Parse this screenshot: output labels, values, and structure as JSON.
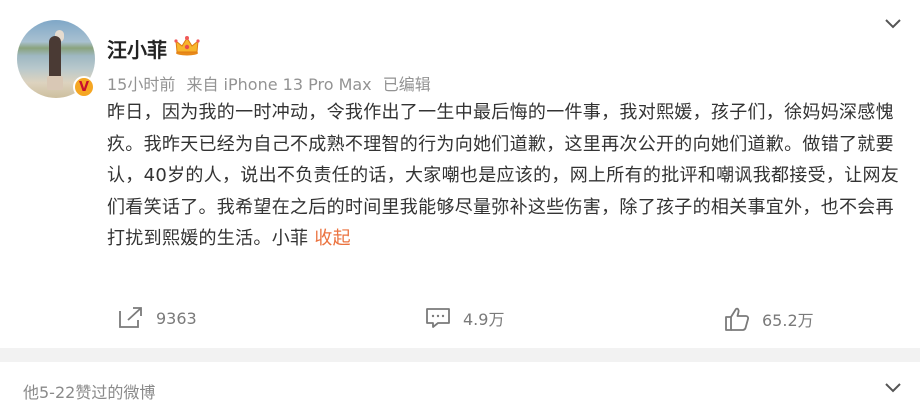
{
  "user": {
    "name": "汪小菲",
    "avatar_icon": "avatar-photo",
    "badge_label": "V",
    "crown_icon": "crown-icon"
  },
  "meta": {
    "time": "15小时前",
    "source": "来自 iPhone 13 Pro Max",
    "edited": "已编辑"
  },
  "post": {
    "text": "昨日，因为我的一时冲动，令我作出了一生中最后悔的一件事，我对熙媛，孩子们，徐妈妈深感愧疚。我昨天已经为自己不成熟不理智的行为向她们道歉，这里再次公开的向她们道歉。做错了就要认，40岁的人，说出不负责任的话，大家嘲也是应该的，网上所有的批评和嘲讽我都接受，让网友们看笑话了。我希望在之后的时间里我能够尽量弥补这些伤害，除了孩子的相关事宜外，也不会再打扰到熙媛的生活。小菲",
    "collapse_label": "收起"
  },
  "actions": {
    "repost_count": "9363",
    "comment_count": "4.9万",
    "like_count": "65.2万"
  },
  "footer": {
    "liked_label": "他5-22赞过的微博"
  },
  "colors": {
    "accent": "#eb7340",
    "badge": "#f5a623",
    "text": "#333333",
    "meta": "#939393"
  }
}
